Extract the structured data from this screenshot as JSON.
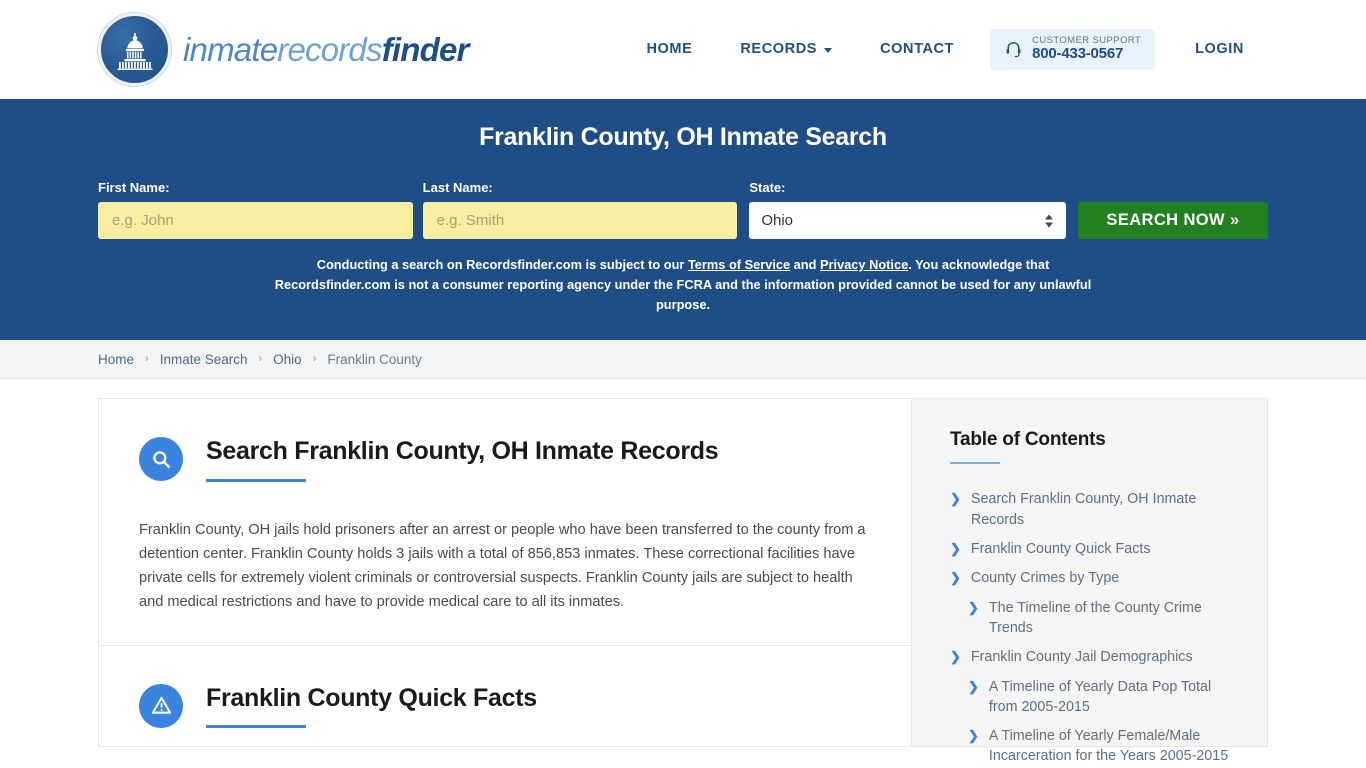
{
  "header": {
    "brand": {
      "part1": "inmate",
      "part2": "records",
      "part3": "finder",
      "logo_icon": "capitol-dome-icon"
    },
    "nav": [
      {
        "label": "HOME",
        "name": "nav-home",
        "caret": false
      },
      {
        "label": "RECORDS",
        "name": "nav-records",
        "caret": true
      },
      {
        "label": "CONTACT",
        "name": "nav-contact",
        "caret": false
      }
    ],
    "support": {
      "icon": "headset-icon",
      "label": "CUSTOMER SUPPORT",
      "phone": "800-433-0567"
    },
    "login_label": "LOGIN"
  },
  "hero": {
    "title": "Franklin County, OH Inmate Search",
    "first_name": {
      "label": "First Name:",
      "value": "",
      "placeholder": "e.g. John"
    },
    "last_name": {
      "label": "Last Name:",
      "value": "",
      "placeholder": "e.g. Smith"
    },
    "state": {
      "label": "State:",
      "value": "Ohio"
    },
    "search_button": "SEARCH NOW »",
    "disclaimer": {
      "part1": "Conducting a search on Recordsfinder.com is subject to our ",
      "link1": "Terms of Service",
      "part2": " and ",
      "link2": "Privacy Notice",
      "part3": ". You acknowledge that Recordsfinder.com is not a consumer reporting agency under the FCRA and the information provided cannot be used for any unlawful purpose."
    }
  },
  "breadcrumb": [
    {
      "label": "Home",
      "current": false
    },
    {
      "label": "Inmate Search",
      "current": false
    },
    {
      "label": "Ohio",
      "current": false
    },
    {
      "label": "Franklin County",
      "current": true
    }
  ],
  "main": {
    "sections": [
      {
        "icon": "magnifier-icon",
        "title": "Search Franklin County, OH Inmate Records",
        "body": "Franklin County, OH jails hold prisoners after an arrest or people who have been transferred to the county from a detention center. Franklin County holds 3 jails with a total of 856,853 inmates. These correctional facilities have private cells for extremely violent criminals or controversial suspects. Franklin County jails are subject to health and medical restrictions and have to provide medical care to all its inmates."
      },
      {
        "icon": "warning-triangle-icon",
        "title": "Franklin County Quick Facts",
        "body": ""
      }
    ]
  },
  "sidebar": {
    "title": "Table of Contents",
    "items": [
      {
        "label": "Search Franklin County, OH Inmate Records",
        "sub": false
      },
      {
        "label": "Franklin County Quick Facts",
        "sub": false
      },
      {
        "label": "County Crimes by Type",
        "sub": false
      },
      {
        "label": "The Timeline of the County Crime Trends",
        "sub": true
      },
      {
        "label": "Franklin County Jail Demographics",
        "sub": false
      },
      {
        "label": "A Timeline of Yearly Data Pop Total from 2005-2015",
        "sub": true
      },
      {
        "label": "A Timeline of Yearly Female/Male Incarceration for the Years 2005-2015",
        "sub": true
      }
    ]
  },
  "colors": {
    "brand_blue": "#1f4e87",
    "accent_blue": "#3a84e0",
    "button_green": "#218121",
    "input_yellow": "#fbeda0",
    "sidebar_bg": "#f5f5f5"
  }
}
